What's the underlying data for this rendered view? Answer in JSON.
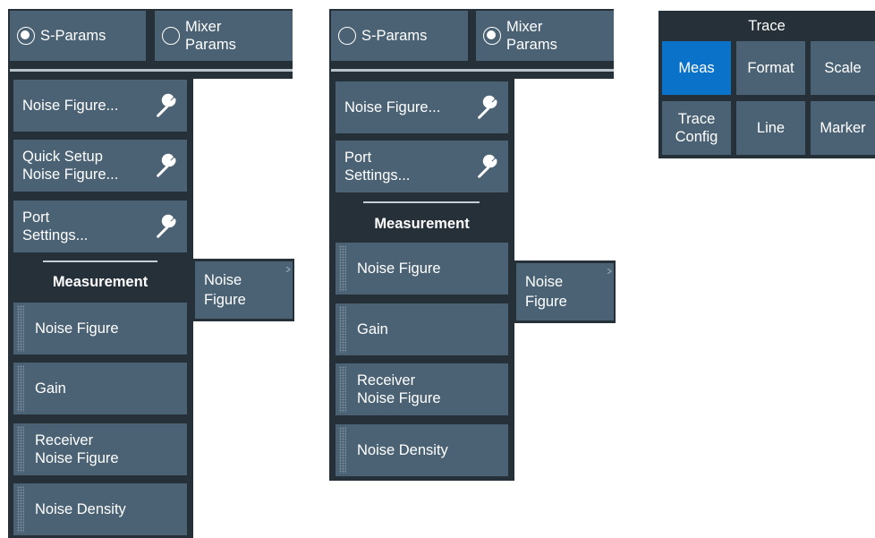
{
  "left_panel": {
    "mode_tabs": [
      {
        "label": "S-Params",
        "selected": true
      },
      {
        "label": "Mixer\nParams",
        "selected": false
      }
    ],
    "softkeys": [
      {
        "label": "Noise Figure...",
        "icon": "wrench-icon"
      },
      {
        "label": "Quick Setup\nNoise Figure...",
        "icon": "wrench-icon"
      },
      {
        "label": "Port\nSettings...",
        "icon": "wrench-icon"
      }
    ],
    "measurement_heading": "Measurement",
    "measurements": [
      "Noise Figure",
      "Gain",
      "Receiver\nNoise Figure",
      "Noise Density"
    ],
    "flyout_label": "Noise\nFigure"
  },
  "middle_panel": {
    "mode_tabs": [
      {
        "label": "S-Params",
        "selected": false
      },
      {
        "label": "Mixer\nParams",
        "selected": true
      }
    ],
    "softkeys": [
      {
        "label": "Noise Figure...",
        "icon": "wrench-icon"
      },
      {
        "label": "Port\nSettings...",
        "icon": "wrench-icon"
      }
    ],
    "measurement_heading": "Measurement",
    "measurements": [
      "Noise Figure",
      "Gain",
      "Receiver\nNoise Figure",
      "Noise Density"
    ],
    "flyout_label": "Noise\nFigure"
  },
  "trace_panel": {
    "title": "Trace",
    "buttons": [
      {
        "label": "Meas",
        "active": true
      },
      {
        "label": "Format",
        "active": false
      },
      {
        "label": "Scale",
        "active": false
      },
      {
        "label": "Trace\nConfig",
        "active": false
      },
      {
        "label": "Line",
        "active": false
      },
      {
        "label": "Marker",
        "active": false
      }
    ]
  },
  "colors": {
    "panel_bg": "#253039",
    "button_bg": "#4a6273",
    "active_button": "#0a72c8",
    "separator": "#c5ced4"
  }
}
